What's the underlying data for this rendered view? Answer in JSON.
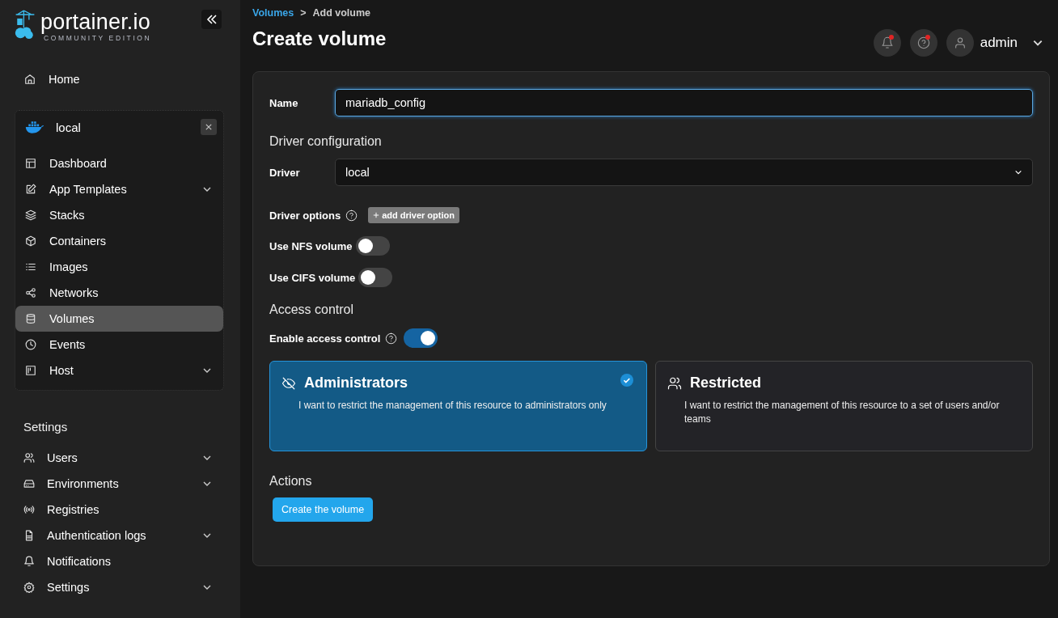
{
  "sidebar": {
    "logo": {
      "name": "portainer.io",
      "edition": "COMMUNITY EDITION"
    },
    "home": {
      "label": "Home",
      "selected": false
    },
    "environment": {
      "name": "local",
      "items": [
        {
          "label": "Dashboard",
          "expandable": false,
          "selected": false
        },
        {
          "label": "App Templates",
          "expandable": true,
          "selected": false
        },
        {
          "label": "Stacks",
          "expandable": false,
          "selected": false
        },
        {
          "label": "Containers",
          "expandable": false,
          "selected": false
        },
        {
          "label": "Images",
          "expandable": false,
          "selected": false
        },
        {
          "label": "Networks",
          "expandable": false,
          "selected": false
        },
        {
          "label": "Volumes",
          "expandable": false,
          "selected": true
        },
        {
          "label": "Events",
          "expandable": false,
          "selected": false
        },
        {
          "label": "Host",
          "expandable": true,
          "selected": false
        }
      ]
    },
    "settings_heading": "Settings",
    "settings_items": [
      {
        "label": "Users",
        "expandable": true,
        "selected": false
      },
      {
        "label": "Environments",
        "expandable": true,
        "selected": false
      },
      {
        "label": "Registries",
        "expandable": false,
        "selected": false
      },
      {
        "label": "Authentication logs",
        "expandable": true,
        "selected": false
      },
      {
        "label": "Notifications",
        "expandable": false,
        "selected": false
      },
      {
        "label": "Settings",
        "expandable": true,
        "selected": false
      }
    ]
  },
  "breadcrumb": {
    "link": "Volumes",
    "separator": ">",
    "current": "Add volume"
  },
  "page_title": "Create volume",
  "header": {
    "notifications_unread": true,
    "help_unread": true,
    "user": "admin"
  },
  "form": {
    "name": {
      "label": "Name",
      "value": "mariadb_config"
    },
    "driver_heading": "Driver configuration",
    "driver": {
      "label": "Driver",
      "value": "local"
    },
    "driver_options": {
      "label": "Driver options",
      "button": "add driver option"
    },
    "toggles": [
      {
        "label": "Use NFS volume",
        "on": false
      },
      {
        "label": "Use CIFS volume",
        "on": false
      }
    ],
    "access_heading": "Access control",
    "access_toggle": {
      "label": "Enable access control",
      "on": true
    },
    "access_options": [
      {
        "title": "Administrators",
        "description": "I want to restrict the management of this resource to administrators only",
        "selected": true
      },
      {
        "title": "Restricted",
        "description": "I want to restrict the management of this resource to a set of users and/or teams",
        "selected": false
      }
    ],
    "actions_heading": "Actions",
    "submit": "Create the volume"
  }
}
